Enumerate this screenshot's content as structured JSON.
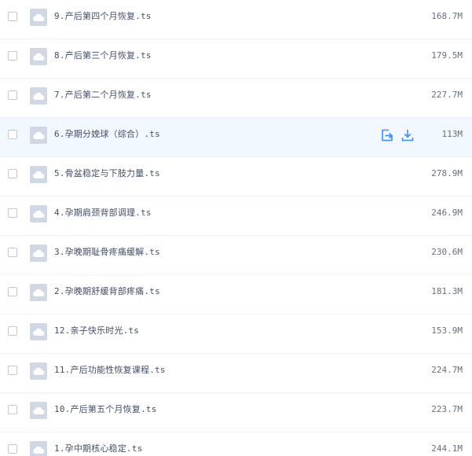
{
  "files": [
    {
      "name": "9.产后第四个月恢复.ts",
      "size": "168.7M",
      "hovered": false
    },
    {
      "name": "8.产后第三个月恢复.ts",
      "size": "179.5M",
      "hovered": false
    },
    {
      "name": "7.产后第二个月恢复.ts",
      "size": "227.7M",
      "hovered": false
    },
    {
      "name": "6.孕期分娩球（综合）.ts",
      "size": "113M",
      "hovered": true
    },
    {
      "name": "5.骨盆稳定与下肢力量.ts",
      "size": "278.9M",
      "hovered": false
    },
    {
      "name": "4.孕期肩颈背部调理.ts",
      "size": "246.9M",
      "hovered": false
    },
    {
      "name": "3.孕晚期耻骨疼痛缓解.ts",
      "size": "230.6M",
      "hovered": false
    },
    {
      "name": "2.孕晚期舒缓背部疼痛.ts",
      "size": "181.3M",
      "hovered": false
    },
    {
      "name": "12.亲子快乐时光.ts",
      "size": "153.9M",
      "hovered": false
    },
    {
      "name": "11.产后功能性恢复课程.ts",
      "size": "224.7M",
      "hovered": false
    },
    {
      "name": "10.产后第五个月恢复.ts",
      "size": "223.7M",
      "hovered": false
    },
    {
      "name": "1.孕中期核心稳定.ts",
      "size": "244.1M",
      "hovered": false
    }
  ],
  "colors": {
    "accent": "#3b8cff",
    "hover_row": "#f2f8ff",
    "icon_bg": "#cfd8e4"
  },
  "icons": {
    "file": "cloud-file-icon",
    "share": "share-icon",
    "download": "download-icon"
  }
}
